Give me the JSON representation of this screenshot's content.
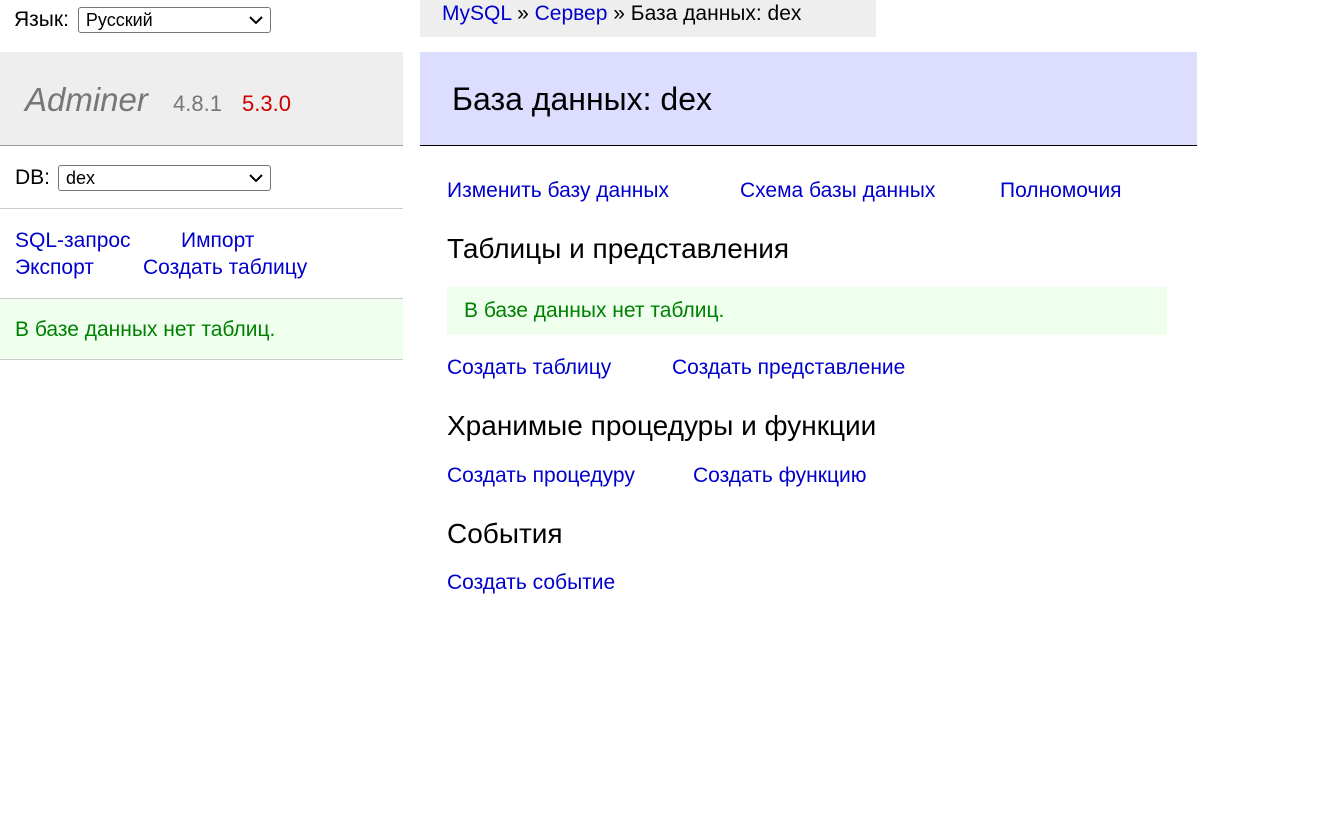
{
  "language": {
    "label": "Язык:",
    "selected": "Русский"
  },
  "logo": {
    "name": "Adminer",
    "version": "4.8.1",
    "new_version": "5.3.0"
  },
  "db_select": {
    "label": "DB:",
    "selected": "dex"
  },
  "sidebar": {
    "links": {
      "sql": "SQL-запрос",
      "import": "Импорт",
      "export": "Экспорт",
      "create_table": "Создать таблицу"
    },
    "message": "В базе данных нет таблиц."
  },
  "breadcrumb": {
    "mysql": "MySQL",
    "sep": "»",
    "server": "Сервер",
    "current": "База данных: dex"
  },
  "header": {
    "title": "База данных: dex"
  },
  "main": {
    "links": {
      "alter_db": "Изменить базу данных",
      "db_schema": "Схема базы данных",
      "privileges": "Полномочия"
    },
    "tables": {
      "heading": "Таблицы и представления",
      "message": "В базе данных нет таблиц.",
      "create_table": "Создать таблицу",
      "create_view": "Создать представление"
    },
    "routines": {
      "heading": "Хранимые процедуры и функции",
      "create_procedure": "Создать процедуру",
      "create_function": "Создать функцию"
    },
    "events": {
      "heading": "События",
      "create_event": "Создать событие"
    }
  },
  "colors": {
    "link": "#0000cc",
    "header_bg": "#ddddff",
    "message_bg": "#eeffee",
    "message_text": "#008000",
    "new_version": "#cc0000"
  }
}
